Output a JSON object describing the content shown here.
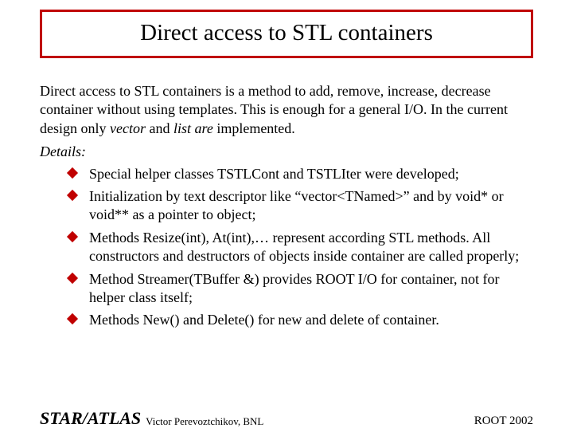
{
  "title": "Direct access to STL containers",
  "intro_prefix": "Direct access to STL containers is a method to add, remove, increase, decrease container without using templates. This is enough for a general I/O. In the current design only ",
  "intro_em1": "vector",
  "intro_mid": " and ",
  "intro_em2": "list are",
  "intro_suffix": " implemented.",
  "details_label": "Details:",
  "bullets": [
    "Special helper classes TSTLCont and TSTLIter were developed;",
    "Initialization by text descriptor like “vector<TNamed>” and by void* or void** as a pointer to object;",
    "Methods Resize(int), At(int),… represent according STL methods. All constructors and destructors of objects inside container are called properly;",
    "Method Streamer(TBuffer &) provides ROOT I/O for container, not for helper class itself;",
    "Methods New() and Delete() for new and delete of container."
  ],
  "footer": {
    "brand": "STAR/ATLAS",
    "author": "Victor Perevoztchikov, BNL",
    "conference": "ROOT 2002"
  }
}
